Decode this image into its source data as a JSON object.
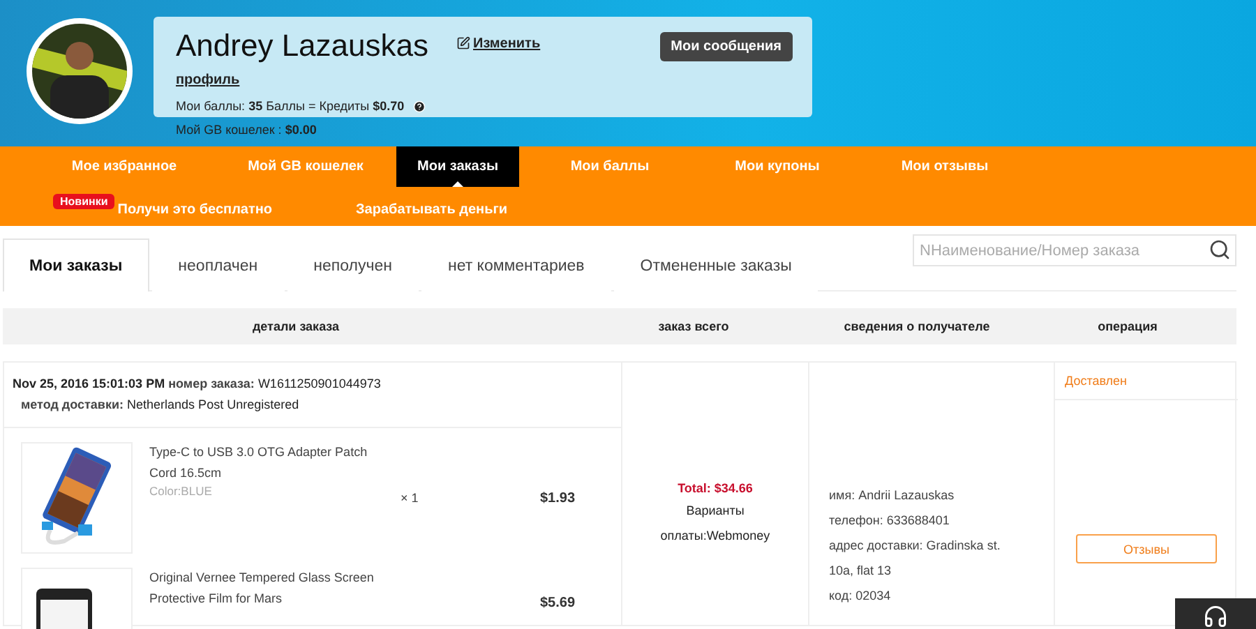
{
  "profile": {
    "name": "Andrey Lazauskas",
    "edit_link": "Изменить",
    "profile_link": "профиль",
    "points": "Мои баллы: **35** Баллы = Кредиты **$0.70**",
    "wallet": "Мой GB кошелек : **$0.00**",
    "messages_button": "Мои сообщения"
  },
  "nav": {
    "items": [
      {
        "label": "Мое избранное",
        "selected": false
      },
      {
        "label": "Мой GB кошелек",
        "selected": false
      },
      {
        "label": "Мои заказы",
        "selected": true
      },
      {
        "label": "Мои баллы",
        "selected": false
      },
      {
        "label": "Мои купоны",
        "selected": false
      },
      {
        "label": "Мои отзывы",
        "selected": false
      }
    ],
    "badge": "Новинки",
    "extra": [
      "Получи это бесплатно",
      "Зарабатывать деньги"
    ]
  },
  "tabs": [
    {
      "label": "Мои заказы",
      "selected": true
    },
    {
      "label": "неоплачен",
      "selected": false
    },
    {
      "label": "неполучен",
      "selected": false
    },
    {
      "label": "нет комментариев",
      "selected": false
    },
    {
      "label": "Отмененные заказы",
      "selected": false
    }
  ],
  "search": {
    "placeholder": "NНаименование/Номер заказа"
  },
  "table": {
    "columns": [
      "детали заказа",
      "заказ всего",
      "сведения о получателе",
      "операция"
    ]
  },
  "order": {
    "date": "Nov 25, 2016 15:01:03 PM",
    "number_label": "номер заказа:",
    "number": "W1611250901044973",
    "delivery_label": "метод доставки:",
    "delivery": "Netherlands Post Unregistered",
    "items": [
      {
        "title": "Type-C to USB 3.0 OTG Adapter Patch Cord 16.5cm",
        "variant": "Color:BLUE",
        "qty": "× 1",
        "price": "$1.93"
      },
      {
        "title": "Original Vernee Tempered Glass Screen Protective Film for Mars",
        "price": "$5.69"
      }
    ],
    "total": "Total: $34.66",
    "payment": "Варианты оплаты:Webmoney",
    "recipient": [
      "имя: Andrii Lazauskas",
      "телефон: 633688401",
      "адрес доставки: Gradinska st. 10a, flat 13",
      "код: 02034"
    ],
    "status": "Доставлен",
    "review_button": "Отзывы"
  }
}
